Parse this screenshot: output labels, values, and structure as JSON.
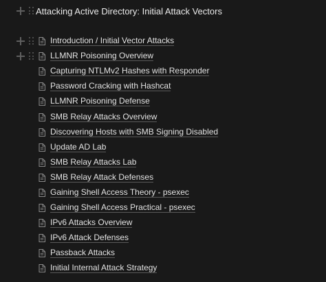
{
  "page": {
    "title": "Attacking Active Directory: Initial Attack Vectors"
  },
  "icons": {
    "add_block": "plus-icon",
    "drag_handle": "drag-handle-icon",
    "page_link": "page-icon"
  },
  "colors": {
    "background": "#191919",
    "text": "#e3e3e3",
    "icon": "#8a8a8a",
    "underline": "#5a5a5a"
  },
  "pages": [
    {
      "label": "Introduction / Initial Vector Attacks"
    },
    {
      "label": "LLMNR Poisoning Overview"
    },
    {
      "label": "Capturing NTLMv2 Hashes with Responder"
    },
    {
      "label": "Password Cracking with Hashcat"
    },
    {
      "label": "LLMNR Poisoning Defense"
    },
    {
      "label": "SMB Relay Attacks Overview"
    },
    {
      "label": "Discovering Hosts with SMB Signing Disabled"
    },
    {
      "label": "Update AD Lab"
    },
    {
      "label": "SMB Relay Attacks Lab"
    },
    {
      "label": "SMB Relay Attack Defenses"
    },
    {
      "label": "Gaining Shell Access Theory - psexec"
    },
    {
      "label": "Gaining Shell Access Practical - psexec"
    },
    {
      "label": "IPv6 Attacks Overview"
    },
    {
      "label": "IPv6 Attack Defenses"
    },
    {
      "label": "Passback Attacks"
    },
    {
      "label": "Initial Internal Attack Strategy"
    }
  ]
}
